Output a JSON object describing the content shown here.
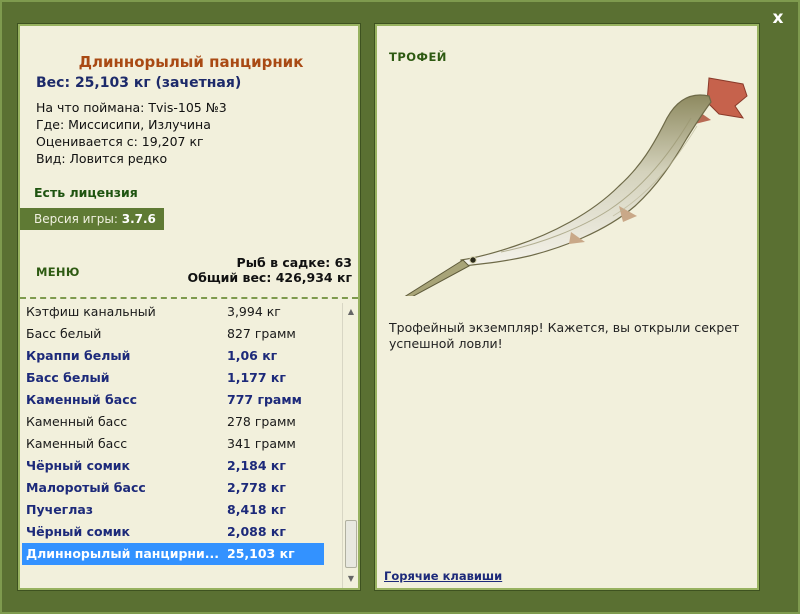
{
  "window": {
    "close_label": "x"
  },
  "fish_card": {
    "title": "Длиннорылый панцирник",
    "weight": "Вес: 25,103 кг (зачетная)",
    "info": [
      "На что поймана: Tvis-105 №3",
      "Где: Миссисипи, Излучина",
      "Оценивается с: 19,207 кг",
      "Вид: Ловится редко"
    ],
    "license": "Есть лицензия",
    "version_label": "Версия игры:",
    "version_value": "3.7.6"
  },
  "menu": {
    "label": "МЕНЮ"
  },
  "cage": {
    "count": "Рыб в садке: 63",
    "total": "Общий вес: 426,934 кг"
  },
  "catch_list": [
    {
      "name": "Кэтфиш канальный",
      "weight": "3,994 кг",
      "style": "normal"
    },
    {
      "name": "Басс белый",
      "weight": "827 грамм",
      "style": "normal"
    },
    {
      "name": "Краппи белый",
      "weight": "1,06 кг",
      "style": "bold"
    },
    {
      "name": "Басс белый",
      "weight": "1,177 кг",
      "style": "bold"
    },
    {
      "name": "Каменный басс",
      "weight": "777 грамм",
      "style": "bold"
    },
    {
      "name": "Каменный басс",
      "weight": "278 грамм",
      "style": "normal"
    },
    {
      "name": "Каменный басс",
      "weight": "341 грамм",
      "style": "normal"
    },
    {
      "name": "Чёрный сомик",
      "weight": "2,184 кг",
      "style": "bold"
    },
    {
      "name": "Малоротый басс",
      "weight": "2,778 кг",
      "style": "bold"
    },
    {
      "name": "Пучеглаз",
      "weight": "8,418 кг",
      "style": "bold"
    },
    {
      "name": "Чёрный сомик",
      "weight": "2,088 кг",
      "style": "bold"
    },
    {
      "name": "Длиннорылый панцирни...",
      "weight": "25,103 кг",
      "style": "selected"
    }
  ],
  "trophy": {
    "label": "ТРОФЕЙ",
    "description": "Трофейный экземпляр! Кажется, вы открыли секрет успешной ловли!",
    "hotkeys": "Горячие клавиши"
  },
  "colors": {
    "background": "#566d30",
    "panel": "#f2f0dc",
    "title": "#a94a14",
    "accent_blue": "#1d2a7a",
    "selected": "#3392ff",
    "green_text": "#2e5a12"
  }
}
